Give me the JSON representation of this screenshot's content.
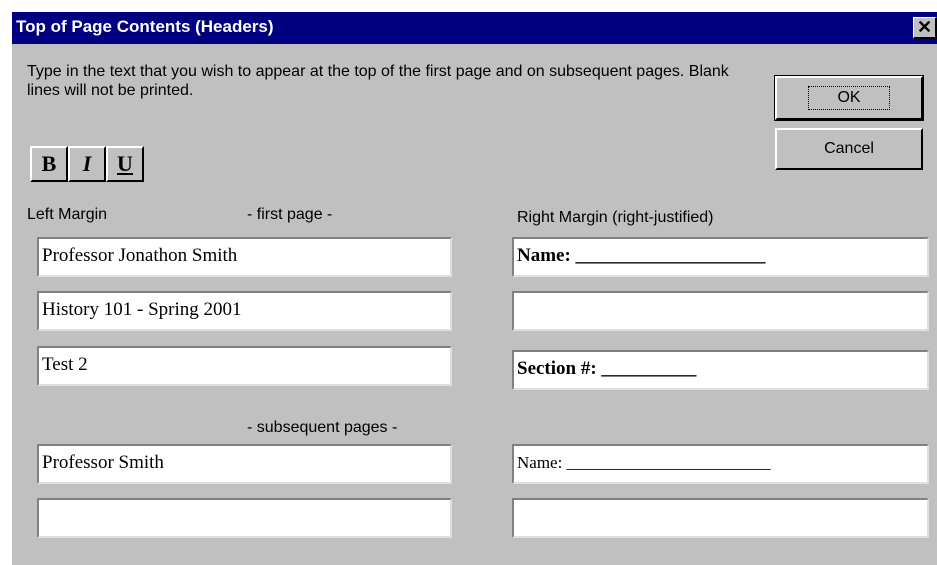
{
  "window": {
    "title": "Top of Page Contents (Headers)",
    "close_glyph": "✕"
  },
  "instructions": "Type in the text that you wish to appear at the top of the first page and on subsequent pages.  Blank lines will not be printed.",
  "buttons": {
    "ok": "OK",
    "cancel": "Cancel"
  },
  "format": {
    "bold": "B",
    "italic": "I",
    "underline": "U"
  },
  "labels": {
    "left_margin": "Left Margin",
    "first_page": "- first page -",
    "subsequent_pages": "- subsequent pages -",
    "right_margin": "Right Margin (right-justified)"
  },
  "left_fields": {
    "first_page": [
      "Professor Jonathon Smith",
      "History 101 - Spring 2001",
      "Test 2"
    ],
    "subsequent": [
      "Professor Smith",
      ""
    ]
  },
  "right_fields": {
    "first_page": [
      "Name: ____________________",
      "",
      "Section #: __________"
    ],
    "subsequent": [
      "Name: ________________________",
      ""
    ]
  }
}
